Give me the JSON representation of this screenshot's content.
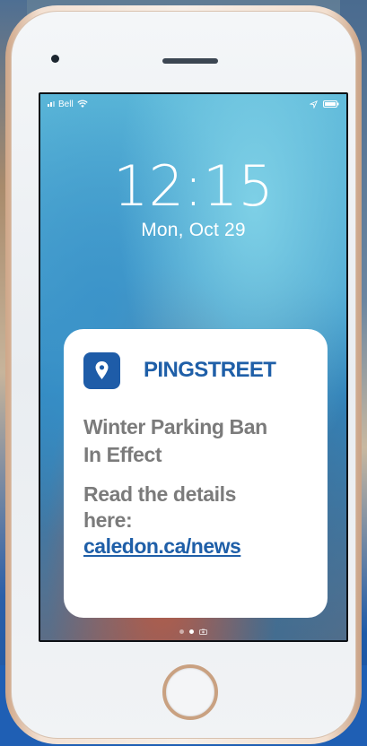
{
  "status_bar": {
    "carrier": "Bell",
    "signal_icon": "signal-bars",
    "wifi_icon": "wifi",
    "location_icon": "location-arrow",
    "battery_icon": "battery"
  },
  "lock_screen": {
    "time": "12:15",
    "date": "Mon, Oct 29"
  },
  "notification": {
    "app_icon": "map-pin",
    "app_name": "PINGSTREET",
    "title": "Winter Parking Ban In Effect",
    "body": "Read the details here:",
    "link": "caledon.ca/news"
  },
  "page_indicator": {
    "pages": 2,
    "active_page": 2,
    "camera_icon": "camera"
  },
  "colors": {
    "brand_blue": "#1e5ca8",
    "text_gray": "#7b7b7b",
    "phone_gold": "#c9a181"
  }
}
